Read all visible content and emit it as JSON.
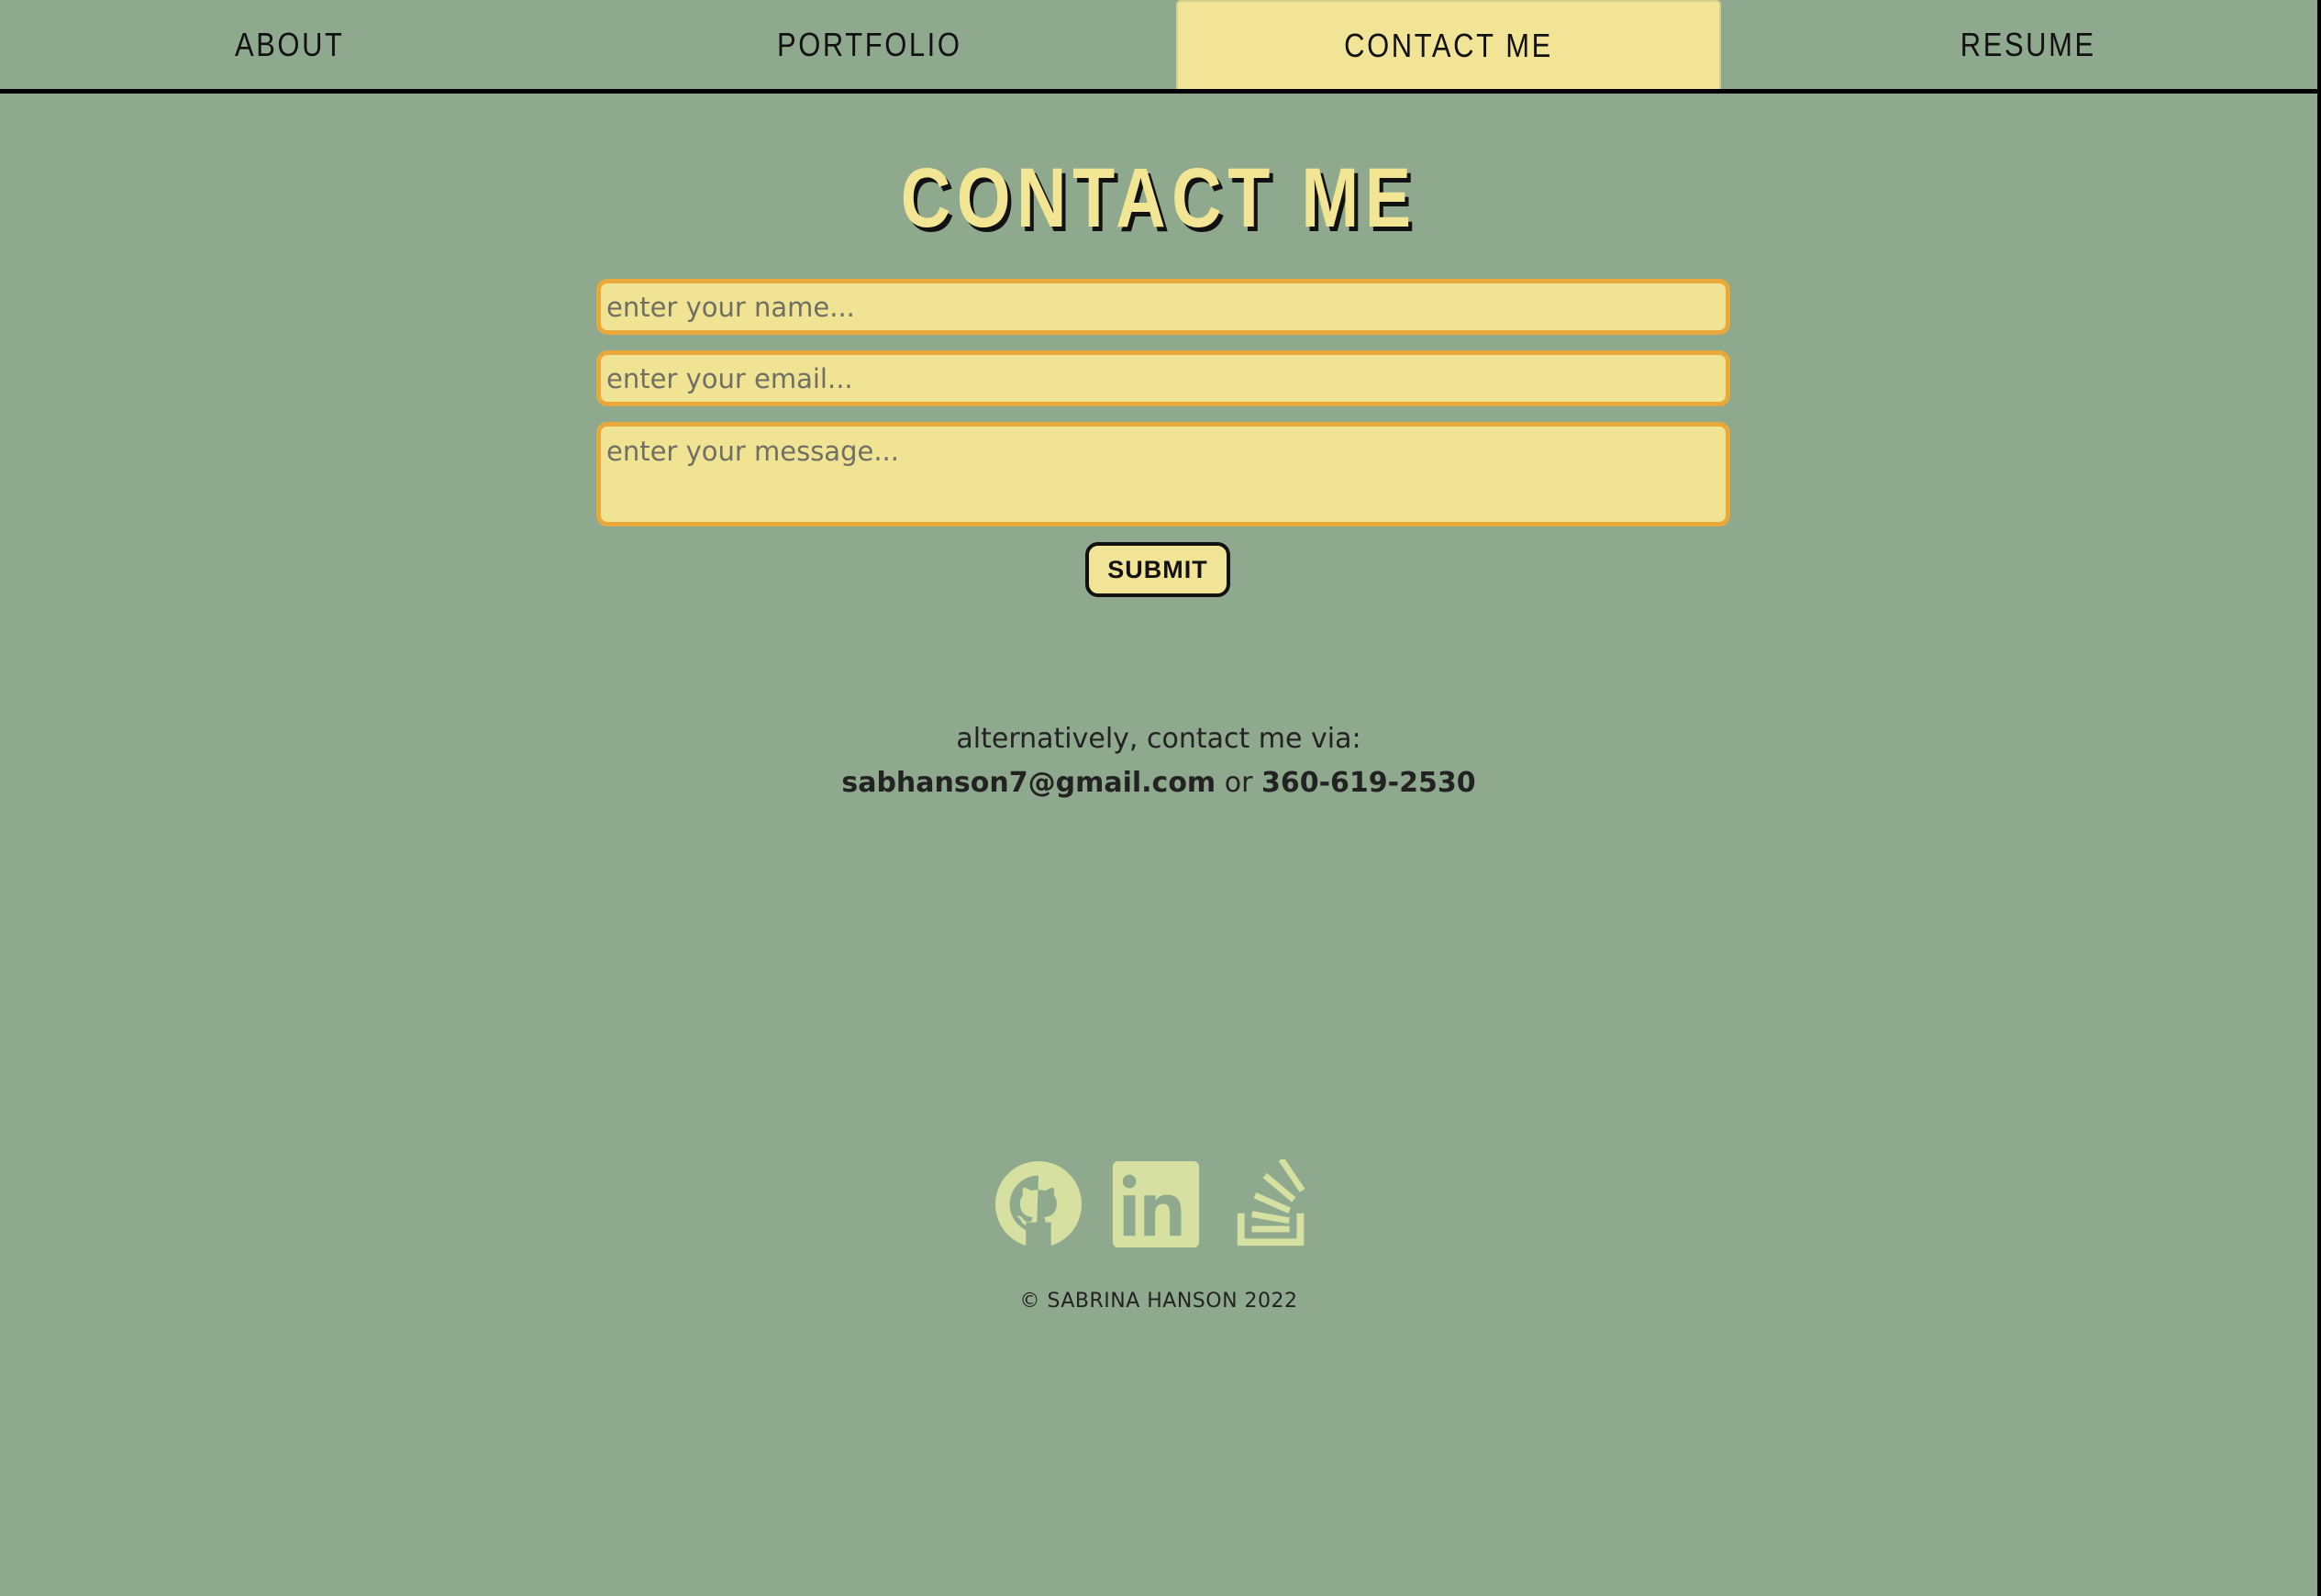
{
  "nav": {
    "items": [
      {
        "label": "ABOUT"
      },
      {
        "label": "PORTFOLIO"
      },
      {
        "label": "CONTACT ME",
        "active": true
      },
      {
        "label": "RESUME"
      }
    ]
  },
  "main": {
    "title": "CONTACT ME",
    "form": {
      "name_placeholder": "enter your name...",
      "email_placeholder": "enter your email...",
      "message_placeholder": "enter your message...",
      "submit_label": "SUBMIT"
    },
    "alt_contact": {
      "intro": "alternatively, contact me via:",
      "email": "sabhanson7@gmail.com",
      "separator": "or",
      "phone": "360-619-2530"
    }
  },
  "social": {
    "icons": [
      "github-icon",
      "linkedin-icon",
      "stackoverflow-icon"
    ]
  },
  "footer": {
    "copyright": "© SABRINA HANSON 2022"
  },
  "colors": {
    "background": "#8fa98f",
    "accent": "#f1e497",
    "field_border": "#e9a93a",
    "icon": "#d6e0a0"
  }
}
